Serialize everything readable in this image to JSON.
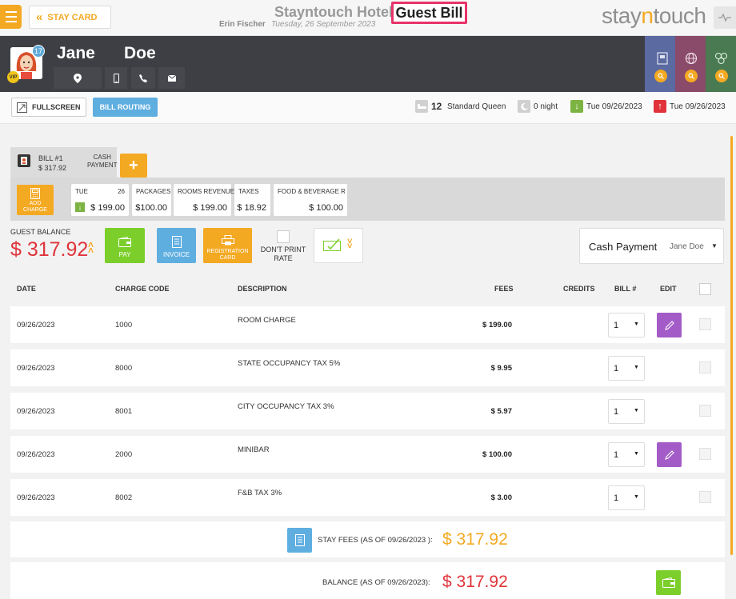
{
  "header": {
    "back_label": "STAY CARD",
    "hotel_name": "Stayntouch Hotel",
    "page_title": "Guest Bill",
    "user_name": "Erin Fischer",
    "date": "Tuesday, 26 September 2023",
    "logo_prefix": "stay",
    "logo_accent": "n",
    "logo_suffix": "touch"
  },
  "guest": {
    "first_name": "Jane",
    "last_name": "Doe",
    "badge_count": "17",
    "vip_label": "VIP"
  },
  "toolbar": {
    "fullscreen_label": "FULLSCREEN",
    "routing_label": "BILL ROUTING",
    "room_number": "12",
    "room_type": "Standard Queen",
    "nights": "0 night",
    "arrival": "Tue 09/26/2023",
    "departure": "Tue 09/26/2023"
  },
  "bill": {
    "name": "BILL #1",
    "amount": "$ 317.92",
    "payment_type_line1": "CASH",
    "payment_type_line2": "PAYMENT",
    "add_label": "+"
  },
  "summary": {
    "add_charge_line1": "ADD",
    "add_charge_line2": "CHARGE",
    "cards": [
      {
        "label": "TUE",
        "extra": "26",
        "value": "$ 199.00"
      },
      {
        "label": "PACKAGES",
        "value": "$100.00"
      },
      {
        "label": "ROOMS REVENUE",
        "value": "$ 199.00"
      },
      {
        "label": "TAXES",
        "value": "$ 18.92"
      },
      {
        "label": "FOOD & BEVERAGE R...",
        "value": "$ 100.00"
      }
    ]
  },
  "actions": {
    "guest_balance_label": "GUEST BALANCE",
    "guest_balance": "$ 317.92",
    "pay_label": "PAY",
    "invoice_label": "INVOICE",
    "registration_line1": "REGISTRATION",
    "registration_line2": "CARD",
    "dont_print_line1": "DON'T PRINT",
    "dont_print_line2": "RATE",
    "payment_method": "Cash Payment",
    "payer": "Jane Doe"
  },
  "table": {
    "headers": {
      "date": "DATE",
      "charge_code": "CHARGE CODE",
      "description": "DESCRIPTION",
      "fees": "FEES",
      "credits": "CREDITS",
      "bill": "BILL #",
      "edit": "EDIT"
    },
    "rows": [
      {
        "date": "09/26/2023",
        "code": "1000",
        "description": "ROOM CHARGE",
        "fee": "$ 199.00",
        "bill": "1"
      },
      {
        "date": "09/26/2023",
        "code": "8000",
        "description": "STATE OCCUPANCY TAX 5%",
        "fee": "$ 9.95",
        "bill": "1"
      },
      {
        "date": "09/26/2023",
        "code": "8001",
        "description": "CITY OCCUPANCY TAX 3%",
        "fee": "$ 5.97",
        "bill": "1"
      },
      {
        "date": "09/26/2023",
        "code": "2000",
        "description": "MINIBAR",
        "fee": "$ 100.00",
        "bill": "1"
      },
      {
        "date": "09/26/2023",
        "code": "8002",
        "description": "F&B TAX 3%",
        "fee": "$ 3.00",
        "bill": "1"
      }
    ]
  },
  "totals": {
    "stay_fees_label": "STAY FEES (AS OF  09/26/2023 ):",
    "stay_fees": "$ 317.92",
    "balance_label": "BALANCE (AS OF  09/26/2023):",
    "balance": "$ 317.92"
  },
  "colors": {
    "accent": "#f4a922",
    "highlight": "#e8336a",
    "balance_red": "#e0343a",
    "pay_green": "#7cce2b",
    "info_blue": "#5faee0",
    "edit_purple": "#a35cc7",
    "header_dark": "#3d3f44"
  }
}
